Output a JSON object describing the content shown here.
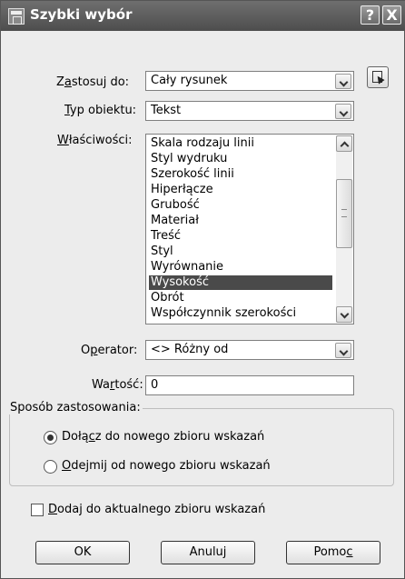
{
  "window": {
    "title": "Szybki wybór",
    "help_button": "?",
    "close_button": "X"
  },
  "apply_to": {
    "label_pre": "Z",
    "label_u": "a",
    "label_post": "stosuj do:",
    "value": "Cały rysunek"
  },
  "object_type": {
    "label_pre": "",
    "label_u": "T",
    "label_post": "yp obiektu:",
    "value": "Tekst"
  },
  "properties": {
    "label_pre": "",
    "label_u": "W",
    "label_post": "łaściwości:",
    "items": [
      "Skala rodzaju linii",
      "Styl wydruku",
      "Szerokość linii",
      "Hiperłącze",
      "Grubość",
      "Materiał",
      "Treść",
      "Styl",
      "Wyrównanie",
      "Wysokość",
      "Obrót",
      "Współczynnik szerokości"
    ],
    "selected_index": 9
  },
  "operator": {
    "label_pre": "O",
    "label_u": "p",
    "label_post": "erator:",
    "value": "<> Różny od"
  },
  "value_field": {
    "label_pre": "Wa",
    "label_u": "r",
    "label_post": "tość:",
    "value": "0"
  },
  "apply_mode": {
    "title": "Sposób zastosowania:",
    "option1": {
      "pre": "Dołą",
      "u": "c",
      "post": "z do nowego zbioru wskazań",
      "checked": true
    },
    "option2": {
      "pre": "",
      "u": "O",
      "post": "dejmij od nowego zbioru wskazań",
      "checked": false
    }
  },
  "append_checkbox": {
    "pre": "",
    "u": "D",
    "post": "odaj do aktualnego zbioru wskazań",
    "checked": false
  },
  "buttons": {
    "ok": "OK",
    "cancel": "Anuluj",
    "help_pre": "Pomo",
    "help_u": "c",
    "help_post": ""
  },
  "colors": {
    "title_bar": "#5e5e5e",
    "selection": "#4a4a4a",
    "dialog_bg": "#ececec"
  }
}
